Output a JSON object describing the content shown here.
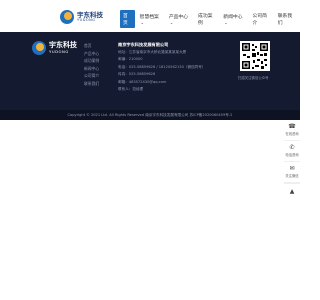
{
  "header": {
    "logo_cn": "宇东科技",
    "logo_en": "YUDONG",
    "nav": [
      {
        "label": "首页",
        "active": true,
        "has_dropdown": false
      },
      {
        "label": "智慧档案",
        "active": false,
        "has_dropdown": true
      },
      {
        "label": "产品中心",
        "active": false,
        "has_dropdown": true
      },
      {
        "label": "成功案例",
        "active": false,
        "has_dropdown": false
      },
      {
        "label": "新闻中心",
        "active": false,
        "has_dropdown": true
      },
      {
        "label": "公司简介",
        "active": false,
        "has_dropdown": false
      },
      {
        "label": "联系我们",
        "active": false,
        "has_dropdown": false
      }
    ]
  },
  "footer": {
    "logo_cn": "宇东科技",
    "logo_en": "YUDONG",
    "links": [
      "首页",
      "产品中心",
      "成功案例",
      "新闻中心",
      "公司简介",
      "联系我们"
    ],
    "company": {
      "name": "南京宇东科技发展有限公司",
      "rows": [
        "地址：江苏省南京市大桥北路某某某某大厦",
        "邮编：210000",
        "电话：025-58859626 / 18120562130（微信同号）",
        "传真：025-58859626",
        "邮箱：463572430@qq.com",
        "联系人：范经理"
      ]
    },
    "qr_caption": "扫描关注微信公众号"
  },
  "bottom": {
    "copyright": "Copyright © 2021 Ltd. All Rights Reserved 南京宇东科技发展有限公司 苏ICP备2020060459号-2"
  },
  "float_toolbar": {
    "items": [
      {
        "icon": "phone-icon",
        "glyph": "☎",
        "label": "在线咨询"
      },
      {
        "icon": "telephone-icon",
        "glyph": "✆",
        "label": "电话咨询"
      },
      {
        "icon": "wechat-icon",
        "glyph": "✉",
        "label": "关注微信"
      }
    ],
    "top_glyph": "▲"
  },
  "colors": {
    "primary": "#1f6fbf",
    "footer_bg": "#141a2f",
    "bottom_bg": "#0e1324",
    "accent": "#f3b23b"
  }
}
